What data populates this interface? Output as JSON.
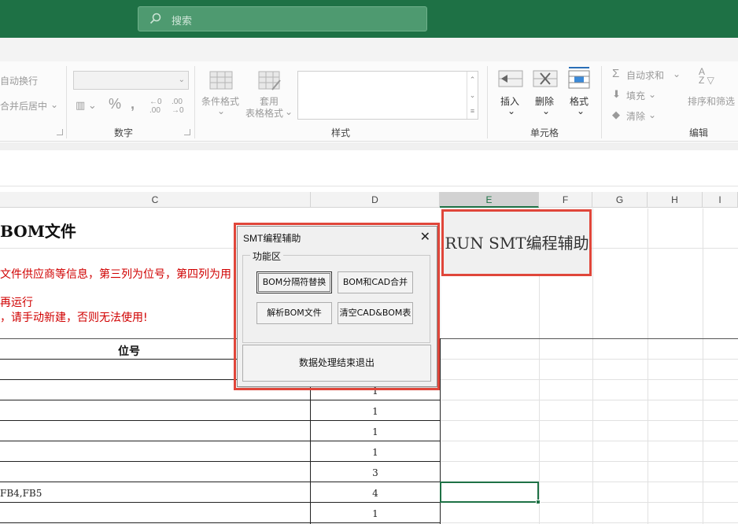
{
  "search": {
    "placeholder": "搜索"
  },
  "ribbon": {
    "wrap_text": "自动换行",
    "merge_center": "合并后居中",
    "number_group": "数字",
    "cond_format": "条件格式",
    "table_format_1": "套用",
    "table_format_2": "表格格式",
    "styles_group": "样式",
    "insert": "插入",
    "delete": "删除",
    "format": "格式",
    "cells_group": "单元格",
    "autosum": "自动求和",
    "fill": "填充",
    "clear": "清除",
    "sort_filter": "排序和筛选",
    "editing_group": "编辑"
  },
  "columns": [
    "C",
    "D",
    "E",
    "F",
    "G",
    "H",
    "I"
  ],
  "sheet": {
    "title": "BOM文件",
    "red_line1": "文件供应商等信息，第三列为位号，第四列为用",
    "red_line2": "再运行",
    "red_line3": "，请手动新建，否则无法使用!",
    "header_pos": "位号",
    "row_fb": "FB4,FB5",
    "d_values": [
      "1",
      "1",
      "1",
      "1",
      "3",
      "4",
      "1"
    ]
  },
  "run_button": {
    "label": "RUN SMT编程辅助"
  },
  "dialog": {
    "title": "SMT编程辅助",
    "group_label": "功能区",
    "btn_replace": "BOM分隔符替换",
    "btn_merge": "BOM和CAD合并",
    "btn_parse": "解析BOM文件",
    "btn_clear": "清空CAD&BOM表",
    "btn_exit": "数据处理结束退出"
  },
  "colors": {
    "accent": "#1e7145",
    "highlight": "#e0463a",
    "warning_text": "#d00000"
  }
}
